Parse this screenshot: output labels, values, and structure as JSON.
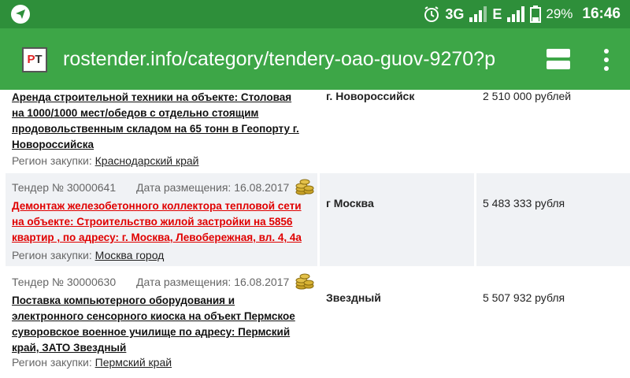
{
  "status_bar": {
    "network_1": "3G",
    "network_2": "E",
    "battery": "29%",
    "time": "16:46",
    "icons": [
      "telegram-icon",
      "alarm-icon",
      "signal-icon",
      "battery-icon"
    ]
  },
  "browser": {
    "favicon_text_1": "Р",
    "favicon_text_2": "Т",
    "url": "rostender.info/category/tendery-oao-guov-9270?p"
  },
  "colors": {
    "status_bar": "#2e8f3a",
    "toolbar": "#3da647",
    "highlight_link": "#e00000",
    "row_shade": "#f0f2f5"
  },
  "tenders": [
    {
      "title": "Аренда строительной техники на объекте: Столовая на 1000/1000 мест/обедов с отдельно стоящим продовольственным складом на 65 тонн в Геопорту г. Новороссийска",
      "region_label": "Регион закупки:",
      "region": "Краснодарский край",
      "city": "г. Новороссийск",
      "price": "2 510 000 рублей"
    },
    {
      "number": "Тендер № 30000641",
      "date": "Дата размещения: 16.08.2017",
      "title": "Демонтаж железобетонного коллектора тепловой сети на объекте: Строительство жилой застройки на 5856 квартир , по адресу: г. Москва, Левобережная, вл. 4, 4а",
      "region_label": "Регион закупки:",
      "region": "Москва город",
      "city": "г Москва",
      "price": "5 483 333 рубля"
    },
    {
      "number": "Тендер № 30000630",
      "date": "Дата размещения: 16.08.2017",
      "title": "Поставка компьютерного оборудования и электронного сенсорного киоска на объект Пермское суворовское военное училище по адресу: Пермский край, ЗАТО Звездный",
      "region_label": "Регион закупки:",
      "region": "Пермский край",
      "city": "Звездный",
      "price": "5 507 932 рубля"
    }
  ]
}
